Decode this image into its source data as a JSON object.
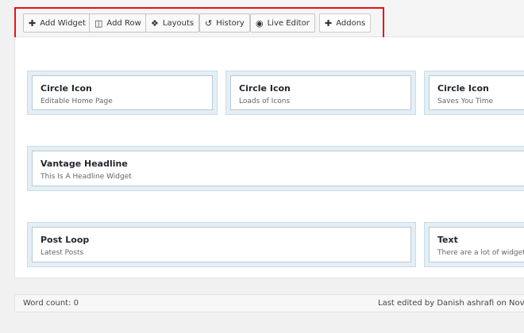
{
  "toolbar": {
    "add_widget": "Add Widget",
    "add_row": "Add Row",
    "layouts": "Layouts",
    "history": "History",
    "live_editor": "Live Editor",
    "addons": "Addons"
  },
  "icons": {
    "add_widget": "plus-icon",
    "add_row": "columns-icon",
    "layouts": "layouts-icon",
    "history": "history-icon",
    "live_editor": "eye-icon",
    "addons": "plus-icon"
  },
  "rows": [
    {
      "cells": [
        {
          "title": "Circle Icon",
          "desc": "Editable Home Page"
        },
        {
          "title": "Circle Icon",
          "desc": "Loads of Icons"
        },
        {
          "title": "Circle Icon",
          "desc": "Saves You Time"
        }
      ]
    },
    {
      "cells": [
        {
          "title": "Vantage Headline",
          "desc": "This Is A Headline Widget"
        }
      ]
    },
    {
      "cells": [
        {
          "title": "Post Loop",
          "desc": "Latest Posts"
        },
        {
          "title": "Text",
          "desc": "There are a lot of widgets"
        }
      ]
    }
  ],
  "footer": {
    "word_count": "Word count: 0",
    "last_edited": "Last edited by Danish ashrafi on Nover"
  },
  "colors": {
    "highlight": "#e8121b",
    "cell_bg": "#e3eef5",
    "widget_border": "#b9c9d6"
  }
}
